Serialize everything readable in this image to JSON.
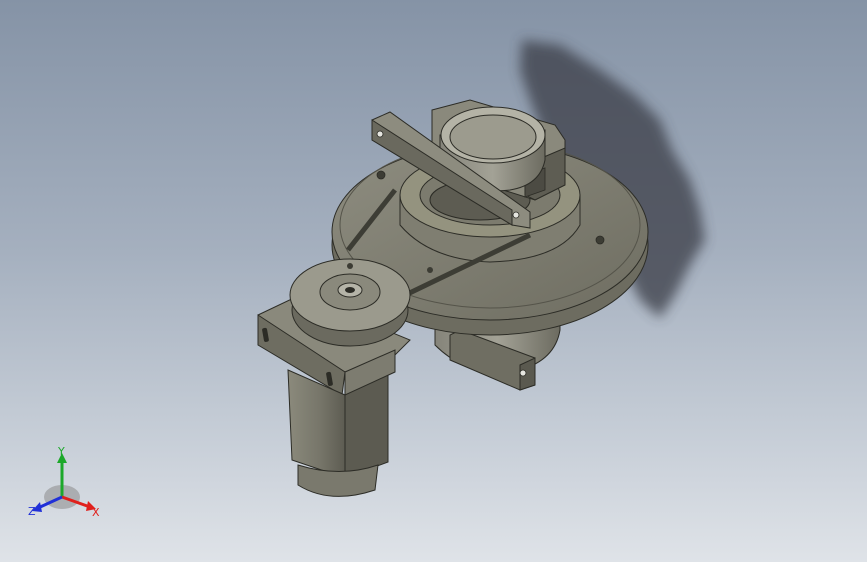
{
  "viewport": {
    "background_top": "#8593a6",
    "background_bottom": "#dfe3e8",
    "model_color": "#7c7b6e",
    "shadow_color": "#3a3e46"
  },
  "triad": {
    "x_label": "X",
    "y_label": "Y",
    "z_label": "Z",
    "x_color": "#e0201c",
    "y_color": "#1ca82a",
    "z_color": "#2030d8"
  }
}
